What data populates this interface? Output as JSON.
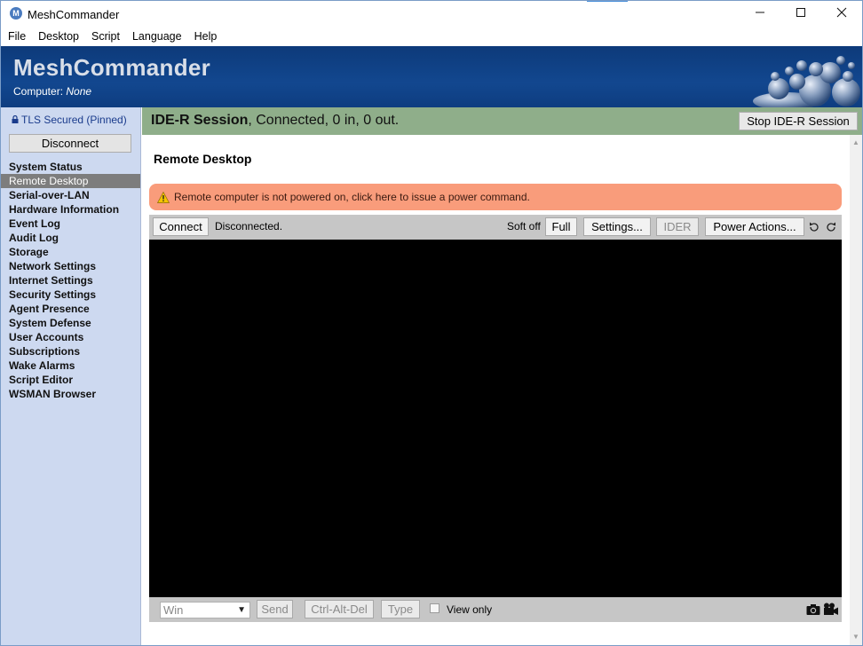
{
  "window": {
    "title": "MeshCommander",
    "app_icon": "M"
  },
  "menu": [
    "File",
    "Desktop",
    "Script",
    "Language",
    "Help"
  ],
  "header": {
    "brand": "MeshCommander",
    "computer_label": "Computer:",
    "computer_value": "None"
  },
  "sidebar": {
    "tls": "TLS Secured (Pinned)",
    "disconnect_label": "Disconnect",
    "items": [
      {
        "label": "System Status"
      },
      {
        "label": "Remote Desktop",
        "active": true
      },
      {
        "label": "Serial-over-LAN"
      },
      {
        "label": "Hardware Information"
      },
      {
        "label": "Event Log"
      },
      {
        "label": "Audit Log"
      },
      {
        "label": "Storage"
      },
      {
        "label": "Network Settings"
      },
      {
        "label": "Internet Settings"
      },
      {
        "label": "Security Settings"
      },
      {
        "label": "Agent Presence"
      },
      {
        "label": "System Defense"
      },
      {
        "label": "User Accounts"
      },
      {
        "label": "Subscriptions"
      },
      {
        "label": "Wake Alarms"
      },
      {
        "label": "Script Editor"
      },
      {
        "label": "WSMAN Browser"
      }
    ]
  },
  "session": {
    "title": "IDE-R Session",
    "status": ", Connected, 0 in, 0 out.",
    "stop_label": "Stop IDE-R Session"
  },
  "main": {
    "title": "Remote Desktop",
    "warning": "Remote computer is not powered on, click here to issue a power command.",
    "toolbar": {
      "connect": "Connect",
      "status": "Disconnected.",
      "power_state": "Soft off",
      "full": "Full",
      "settings": "Settings...",
      "ider": "IDER",
      "power_actions": "Power Actions..."
    },
    "bottom": {
      "key_select": "Win",
      "send": "Send",
      "cad": "Ctrl-Alt-Del",
      "type": "Type",
      "view_only": "View only"
    }
  },
  "colors": {
    "header": "#12478f",
    "sidebar": "#cdd9f0",
    "session_bar": "#8fae8a",
    "warning": "#f99c7b"
  }
}
